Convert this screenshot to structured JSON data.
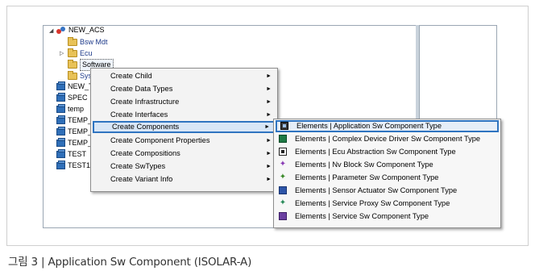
{
  "tree": {
    "nodes": [
      {
        "label": "NEW_ACS"
      },
      {
        "label": "Bsw Mdt"
      },
      {
        "label": "Ecu"
      },
      {
        "label": "Software"
      },
      {
        "label": "Sys"
      },
      {
        "label": "NEW_T"
      },
      {
        "label": "SPEC"
      },
      {
        "label": "temp"
      },
      {
        "label": "TEMP_"
      },
      {
        "label": "TEMP_"
      },
      {
        "label": "TEMP_"
      },
      {
        "label": "TEST"
      },
      {
        "label": "TEST11"
      }
    ]
  },
  "context_menu": {
    "items": [
      {
        "label": "Create Child"
      },
      {
        "label": "Create Data Types"
      },
      {
        "label": "Create Infrastructure"
      },
      {
        "label": "Create Interfaces"
      },
      {
        "label": "Create Components"
      },
      {
        "label": "Create Component Properties"
      },
      {
        "label": "Create Compositions"
      },
      {
        "label": "Create SwTypes"
      },
      {
        "label": "Create Variant Info"
      }
    ],
    "selected": "Create Components"
  },
  "submenu": {
    "items": [
      {
        "label": "Elements | Application Sw Component Type",
        "icon": "application-component-icon"
      },
      {
        "label": "Elements | Complex Device Driver Sw Component Type",
        "icon": "complex-driver-icon"
      },
      {
        "label": "Elements | Ecu Abstraction Sw Component Type",
        "icon": "ecu-abstraction-icon"
      },
      {
        "label": "Elements | Nv Block Sw Component Type",
        "icon": "nv-block-icon"
      },
      {
        "label": "Elements | Parameter Sw Component Type",
        "icon": "parameter-icon"
      },
      {
        "label": "Elements | Sensor Actuator Sw Component Type",
        "icon": "sensor-actuator-icon"
      },
      {
        "label": "Elements | Service Proxy Sw Component Type",
        "icon": "service-proxy-icon"
      },
      {
        "label": "Elements | Service Sw Component Type",
        "icon": "service-icon"
      }
    ],
    "selected": "Elements | Application Sw Component Type"
  },
  "caption": "그림 3 | Application Sw Component (ISOLAR-A)",
  "colors": {
    "highlight_border": "#2f74c0",
    "menu_background": "#f3f3f3"
  }
}
